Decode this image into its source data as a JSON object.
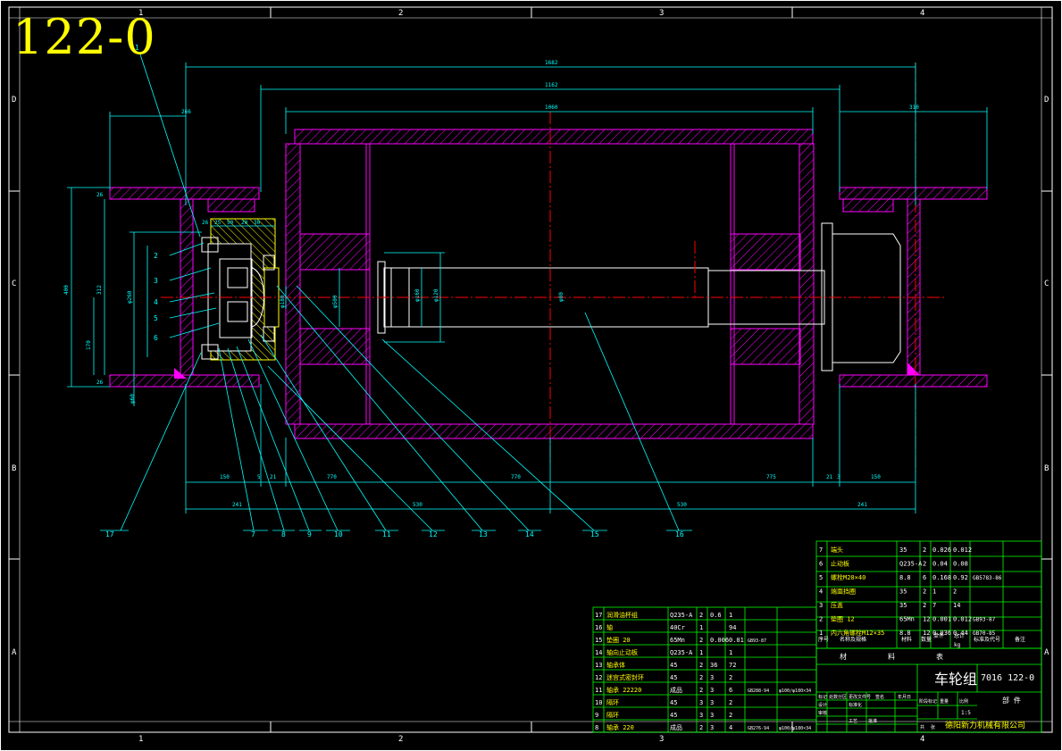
{
  "drawing": {
    "big_label": "122-0",
    "part_title": "车轮组",
    "drawing_number": "7016 122-0",
    "sub_title": "部 件",
    "company": "德阳新力机械有限公司",
    "frame_cols_top": [
      "1",
      "2",
      "3",
      "4"
    ],
    "frame_cols_bottom": [
      "1",
      "2",
      "3",
      "4"
    ],
    "frame_rows_left": [
      "D",
      "C",
      "B",
      "A"
    ],
    "frame_rows_right": [
      "D",
      "C",
      "B",
      "A"
    ]
  },
  "callouts": {
    "top": [
      "1"
    ],
    "left": [
      "2",
      "3",
      "4",
      "5",
      "6"
    ],
    "bottom": [
      "17",
      "7",
      "8",
      "9",
      "10",
      "11",
      "12",
      "13",
      "14",
      "15",
      "16"
    ]
  },
  "dimensions": {
    "top": [
      "1682",
      "1162",
      "1060",
      "266",
      "310"
    ],
    "hub": [
      "26",
      "25",
      "50",
      "20",
      "30"
    ],
    "left": [
      "400",
      "312",
      "170",
      "26",
      "26",
      "φ260",
      "φ60"
    ],
    "center": [
      "φ500",
      "φ160",
      "φ120",
      "φ80",
      "φ180"
    ],
    "bottom_row1": [
      "150",
      "5",
      "21",
      "770",
      "770",
      "775",
      "21",
      "3",
      "150"
    ],
    "bottom_row2": [
      "241",
      "530",
      "530",
      "241"
    ]
  },
  "bom_right": {
    "rows": [
      {
        "no": "7",
        "name": "端头",
        "mat": "35",
        "qty": "2",
        "w1": "0.026",
        "w2": "0.012",
        "std": ""
      },
      {
        "no": "6",
        "name": "止动板",
        "mat": "Q235-A",
        "qty": "2",
        "w1": "0.04",
        "w2": "0.08",
        "std": ""
      },
      {
        "no": "5",
        "name": "螺栓M20×40",
        "mat": "8.8",
        "qty": "6",
        "w1": "0.168",
        "w2": "0.92",
        "std": "GB5783-86"
      },
      {
        "no": "4",
        "name": "端面挡圈",
        "mat": "35",
        "qty": "2",
        "w1": "1",
        "w2": "2",
        "std": ""
      },
      {
        "no": "3",
        "name": "压盖",
        "mat": "35",
        "qty": "2",
        "w1": "7",
        "w2": "14",
        "std": ""
      },
      {
        "no": "2",
        "name": "垫圈 12",
        "mat": "65Mn",
        "qty": "12",
        "w1": "0.001",
        "w2": "0.012",
        "std": "GB93-87"
      },
      {
        "no": "1",
        "name": "内六角螺栓M12×35",
        "mat": "8.8",
        "qty": "12",
        "w1": "0.036",
        "w2": "0.44",
        "std": "GB70-85"
      }
    ],
    "header": {
      "no": "序号",
      "name": "名称及规格",
      "mat": "材料",
      "qty": "数量",
      "w1": "单件",
      "w2": "总计",
      "unit": "kg",
      "std": "标准及代号",
      "note": "备注"
    }
  },
  "bom_left": {
    "rows": [
      {
        "no": "17",
        "name": "润滑油杯组",
        "mat": "Q235-A",
        "qty": "2",
        "w1": "0.6",
        "w2": "1",
        "std": "",
        "note": ""
      },
      {
        "no": "16",
        "name": "轴",
        "mat": "40Cr",
        "qty": "1",
        "w1": "",
        "w2": "94",
        "std": "",
        "note": ""
      },
      {
        "no": "15",
        "name": "垫圈 20",
        "mat": "65Mn",
        "qty": "2",
        "w1": "0.006",
        "w2": "0.01",
        "std": "GB93-87",
        "note": ""
      },
      {
        "no": "14",
        "name": "轴向止动板",
        "mat": "Q235-A",
        "qty": "1",
        "w1": "",
        "w2": "1",
        "std": "",
        "note": ""
      },
      {
        "no": "13",
        "name": "轴承体",
        "mat": "45",
        "qty": "2",
        "w1": "36",
        "w2": "72",
        "std": "",
        "note": ""
      },
      {
        "no": "12",
        "name": "迷宫式密封环",
        "mat": "45",
        "qty": "2",
        "w1": "3",
        "w2": "2",
        "std": "",
        "note": ""
      },
      {
        "no": "11",
        "name": "轴承 22220",
        "mat": "成品",
        "qty": "2",
        "w1": "3",
        "w2": "6",
        "std": "GB288-94",
        "note": "φ100/φ180×34"
      },
      {
        "no": "10",
        "name": "隔环",
        "mat": "45",
        "qty": "3",
        "w1": "3",
        "w2": "2",
        "std": "",
        "note": ""
      },
      {
        "no": "9",
        "name": "隔环",
        "mat": "45",
        "qty": "3",
        "w1": "3",
        "w2": "2",
        "std": "",
        "note": ""
      },
      {
        "no": "8",
        "name": "轴承 220",
        "mat": "成品",
        "qty": "2",
        "w1": "3",
        "w2": "4",
        "std": "GB276-94",
        "note": "φ100/φ180×34"
      }
    ]
  },
  "title_block": {
    "row_a": [
      "标记",
      "处数",
      "分区",
      "更改文件号",
      "签名",
      "年月日"
    ],
    "row_b": [
      "设计",
      "标准化",
      "阶段标记",
      "重量",
      "比例"
    ],
    "row_c": [
      "审核",
      "工艺",
      "批准"
    ],
    "labels_mid": [
      "共",
      "张",
      "第",
      "张"
    ],
    "scale": "1:5",
    "material_row": [
      "材",
      "料",
      "表"
    ]
  },
  "colors": {
    "frame": "#ffffff",
    "green": "#00ff00",
    "cyan": "#00ffff",
    "magenta": "#ff00ff",
    "red": "#ff0000",
    "yellow": "#ffff00",
    "white": "#ffffff"
  }
}
